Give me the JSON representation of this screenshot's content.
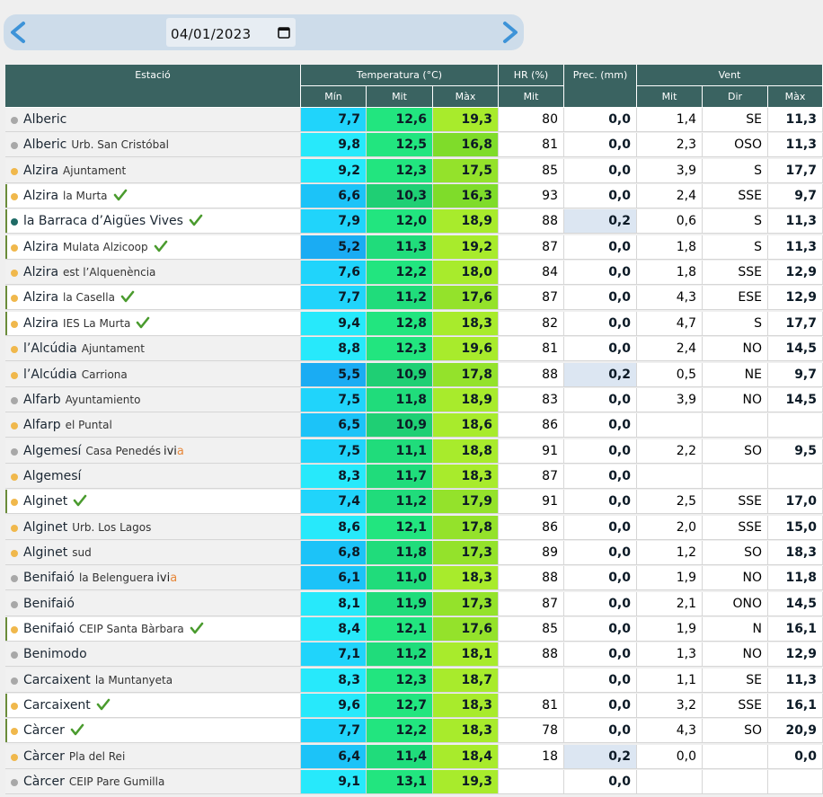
{
  "date": "04/01/2023",
  "colors": {
    "header_bg": "#3a6361",
    "min_low": "#1fb6ff",
    "mit": "#20e07c",
    "max": "#a6ea2a",
    "dot_orange": "#f0b84c",
    "dot_gray": "#a8a8a8",
    "dot_teal": "#1f6b66",
    "check": "#4a9b2e"
  },
  "headers": {
    "estacio": "Estació",
    "temperatura": "Temperatura (°C)",
    "hr": "HR (%)",
    "prec": "Prec. (mm)",
    "vent": "Vent",
    "min": "Mín",
    "mit": "Mit",
    "max": "Màx",
    "hr_mit": "Mit",
    "vent_mit": "Mit",
    "vent_dir": "Dir",
    "vent_max": "Màx"
  },
  "rows": [
    {
      "name": "Alberic",
      "sub": "",
      "dot": "gray",
      "check": false,
      "ivia": false,
      "bar": false,
      "min": "7,7",
      "mit": "12,6",
      "max": "19,3",
      "hr": "80",
      "prec": "0,0",
      "wmit": "1,4",
      "wdir": "SE",
      "wmax": "11,3"
    },
    {
      "name": "Alberic",
      "sub": "Urb. San Cristóbal",
      "dot": "gray",
      "check": false,
      "ivia": false,
      "bar": false,
      "min": "9,8",
      "mit": "12,5",
      "max": "16,8",
      "hr": "81",
      "prec": "0,0",
      "wmit": "2,3",
      "wdir": "OSO",
      "wmax": "11,3"
    },
    {
      "name": "Alzira",
      "sub": "Ajuntament",
      "dot": "orange",
      "check": false,
      "ivia": false,
      "bar": false,
      "min": "9,2",
      "mit": "12,3",
      "max": "17,5",
      "hr": "85",
      "prec": "0,0",
      "wmit": "3,9",
      "wdir": "S",
      "wmax": "17,7"
    },
    {
      "name": "Alzira",
      "sub": "la Murta",
      "dot": "orange",
      "check": true,
      "ivia": false,
      "bar": true,
      "min": "6,6",
      "mit": "10,3",
      "max": "16,3",
      "hr": "93",
      "prec": "0,0",
      "wmit": "2,4",
      "wdir": "SSE",
      "wmax": "9,7"
    },
    {
      "name": "la Barraca d’Aigües Vives",
      "sub": "",
      "dot": "teal",
      "check": true,
      "ivia": false,
      "bar": true,
      "min": "7,9",
      "mit": "12,0",
      "max": "18,9",
      "hr": "88",
      "prec": "0,2",
      "wmit": "0,6",
      "wdir": "S",
      "wmax": "11,3"
    },
    {
      "name": "Alzira",
      "sub": "Mulata Alzicoop",
      "dot": "orange",
      "check": true,
      "ivia": false,
      "bar": true,
      "min": "5,2",
      "mit": "11,3",
      "max": "19,2",
      "hr": "87",
      "prec": "0,0",
      "wmit": "1,8",
      "wdir": "S",
      "wmax": "11,3"
    },
    {
      "name": "Alzira",
      "sub": "est l’Alquenència",
      "dot": "orange",
      "check": false,
      "ivia": false,
      "bar": false,
      "min": "7,6",
      "mit": "12,2",
      "max": "18,0",
      "hr": "84",
      "prec": "0,0",
      "wmit": "1,8",
      "wdir": "SSE",
      "wmax": "12,9"
    },
    {
      "name": "Alzira",
      "sub": "la Casella",
      "dot": "orange",
      "check": true,
      "ivia": false,
      "bar": true,
      "min": "7,7",
      "mit": "11,2",
      "max": "17,6",
      "hr": "87",
      "prec": "0,0",
      "wmit": "4,3",
      "wdir": "ESE",
      "wmax": "12,9"
    },
    {
      "name": "Alzira",
      "sub": "IES La Murta",
      "dot": "orange",
      "check": true,
      "ivia": false,
      "bar": true,
      "min": "9,4",
      "mit": "12,8",
      "max": "18,3",
      "hr": "82",
      "prec": "0,0",
      "wmit": "4,7",
      "wdir": "S",
      "wmax": "17,7"
    },
    {
      "name": "l’Alcúdia",
      "sub": "Ajuntament",
      "dot": "orange",
      "check": false,
      "ivia": false,
      "bar": false,
      "min": "8,8",
      "mit": "12,3",
      "max": "19,6",
      "hr": "81",
      "prec": "0,0",
      "wmit": "2,4",
      "wdir": "NO",
      "wmax": "14,5"
    },
    {
      "name": "l’Alcúdia",
      "sub": "Carriona",
      "dot": "orange",
      "check": false,
      "ivia": false,
      "bar": false,
      "min": "5,5",
      "mit": "10,9",
      "max": "17,8",
      "hr": "88",
      "prec": "0,2",
      "wmit": "0,5",
      "wdir": "NE",
      "wmax": "9,7"
    },
    {
      "name": "Alfarb",
      "sub": "Ayuntamiento",
      "dot": "gray",
      "check": false,
      "ivia": false,
      "bar": false,
      "min": "7,5",
      "mit": "11,8",
      "max": "18,9",
      "hr": "83",
      "prec": "0,0",
      "wmit": "3,9",
      "wdir": "NO",
      "wmax": "14,5"
    },
    {
      "name": "Alfarp",
      "sub": "el Puntal",
      "dot": "orange",
      "check": false,
      "ivia": false,
      "bar": false,
      "min": "6,5",
      "mit": "10,9",
      "max": "18,6",
      "hr": "86",
      "prec": "0,0",
      "wmit": "",
      "wdir": "",
      "wmax": ""
    },
    {
      "name": "Algemesí",
      "sub": "Casa Penedés",
      "dot": "gray",
      "check": false,
      "ivia": true,
      "bar": false,
      "min": "7,5",
      "mit": "11,1",
      "max": "18,8",
      "hr": "91",
      "prec": "0,0",
      "wmit": "2,2",
      "wdir": "SO",
      "wmax": "9,5"
    },
    {
      "name": "Algemesí",
      "sub": "",
      "dot": "orange",
      "check": false,
      "ivia": false,
      "bar": false,
      "min": "8,3",
      "mit": "11,7",
      "max": "18,3",
      "hr": "87",
      "prec": "0,0",
      "wmit": "",
      "wdir": "",
      "wmax": ""
    },
    {
      "name": "Alginet",
      "sub": "",
      "dot": "orange",
      "check": true,
      "ivia": false,
      "bar": true,
      "min": "7,4",
      "mit": "11,2",
      "max": "17,9",
      "hr": "91",
      "prec": "0,0",
      "wmit": "2,5",
      "wdir": "SSE",
      "wmax": "17,0"
    },
    {
      "name": "Alginet",
      "sub": "Urb. Los Lagos",
      "dot": "orange",
      "check": false,
      "ivia": false,
      "bar": false,
      "min": "8,6",
      "mit": "12,1",
      "max": "17,8",
      "hr": "86",
      "prec": "0,0",
      "wmit": "2,0",
      "wdir": "SSE",
      "wmax": "15,0"
    },
    {
      "name": "Alginet",
      "sub": "sud",
      "dot": "orange",
      "check": false,
      "ivia": false,
      "bar": false,
      "min": "6,8",
      "mit": "11,8",
      "max": "17,3",
      "hr": "89",
      "prec": "0,0",
      "wmit": "1,2",
      "wdir": "SO",
      "wmax": "18,3"
    },
    {
      "name": "Benifaió",
      "sub": "la Belenguera",
      "dot": "gray",
      "check": false,
      "ivia": true,
      "bar": false,
      "min": "6,1",
      "mit": "11,0",
      "max": "18,3",
      "hr": "88",
      "prec": "0,0",
      "wmit": "1,9",
      "wdir": "NO",
      "wmax": "11,8"
    },
    {
      "name": "Benifaió",
      "sub": "",
      "dot": "gray",
      "check": false,
      "ivia": false,
      "bar": false,
      "min": "8,1",
      "mit": "11,9",
      "max": "17,3",
      "hr": "87",
      "prec": "0,0",
      "wmit": "2,1",
      "wdir": "ONO",
      "wmax": "14,5"
    },
    {
      "name": "Benifaió",
      "sub": "CEIP Santa Bàrbara",
      "dot": "orange",
      "check": true,
      "ivia": false,
      "bar": true,
      "min": "8,4",
      "mit": "12,1",
      "max": "17,6",
      "hr": "85",
      "prec": "0,0",
      "wmit": "1,9",
      "wdir": "N",
      "wmax": "16,1"
    },
    {
      "name": "Benimodo",
      "sub": "",
      "dot": "gray",
      "check": false,
      "ivia": false,
      "bar": false,
      "min": "7,1",
      "mit": "11,2",
      "max": "18,1",
      "hr": "88",
      "prec": "0,0",
      "wmit": "1,3",
      "wdir": "NO",
      "wmax": "12,9"
    },
    {
      "name": "Carcaixent",
      "sub": "la Muntanyeta",
      "dot": "gray",
      "check": false,
      "ivia": false,
      "bar": false,
      "min": "8,3",
      "mit": "12,3",
      "max": "18,7",
      "hr": "",
      "prec": "0,0",
      "wmit": "1,1",
      "wdir": "SE",
      "wmax": "11,3"
    },
    {
      "name": "Carcaixent",
      "sub": "",
      "dot": "orange",
      "check": true,
      "ivia": false,
      "bar": true,
      "min": "9,6",
      "mit": "12,7",
      "max": "18,3",
      "hr": "81",
      "prec": "0,0",
      "wmit": "3,2",
      "wdir": "SSE",
      "wmax": "16,1"
    },
    {
      "name": "Càrcer",
      "sub": "",
      "dot": "orange",
      "check": true,
      "ivia": false,
      "bar": true,
      "min": "7,7",
      "mit": "12,2",
      "max": "18,3",
      "hr": "78",
      "prec": "0,0",
      "wmit": "4,3",
      "wdir": "SO",
      "wmax": "20,9"
    },
    {
      "name": "Càrcer",
      "sub": "Pla del Rei",
      "dot": "orange",
      "check": false,
      "ivia": false,
      "bar": false,
      "min": "6,4",
      "mit": "11,4",
      "max": "18,4",
      "hr": "18",
      "prec": "0,2",
      "wmit": "0,0",
      "wdir": "",
      "wmax": "0,0"
    },
    {
      "name": "Càrcer",
      "sub": "CEIP Pare Gumilla",
      "dot": "gray",
      "check": false,
      "ivia": false,
      "bar": false,
      "min": "9,1",
      "mit": "13,1",
      "max": "19,3",
      "hr": "",
      "prec": "0,0",
      "wmit": "",
      "wdir": "",
      "wmax": ""
    }
  ]
}
